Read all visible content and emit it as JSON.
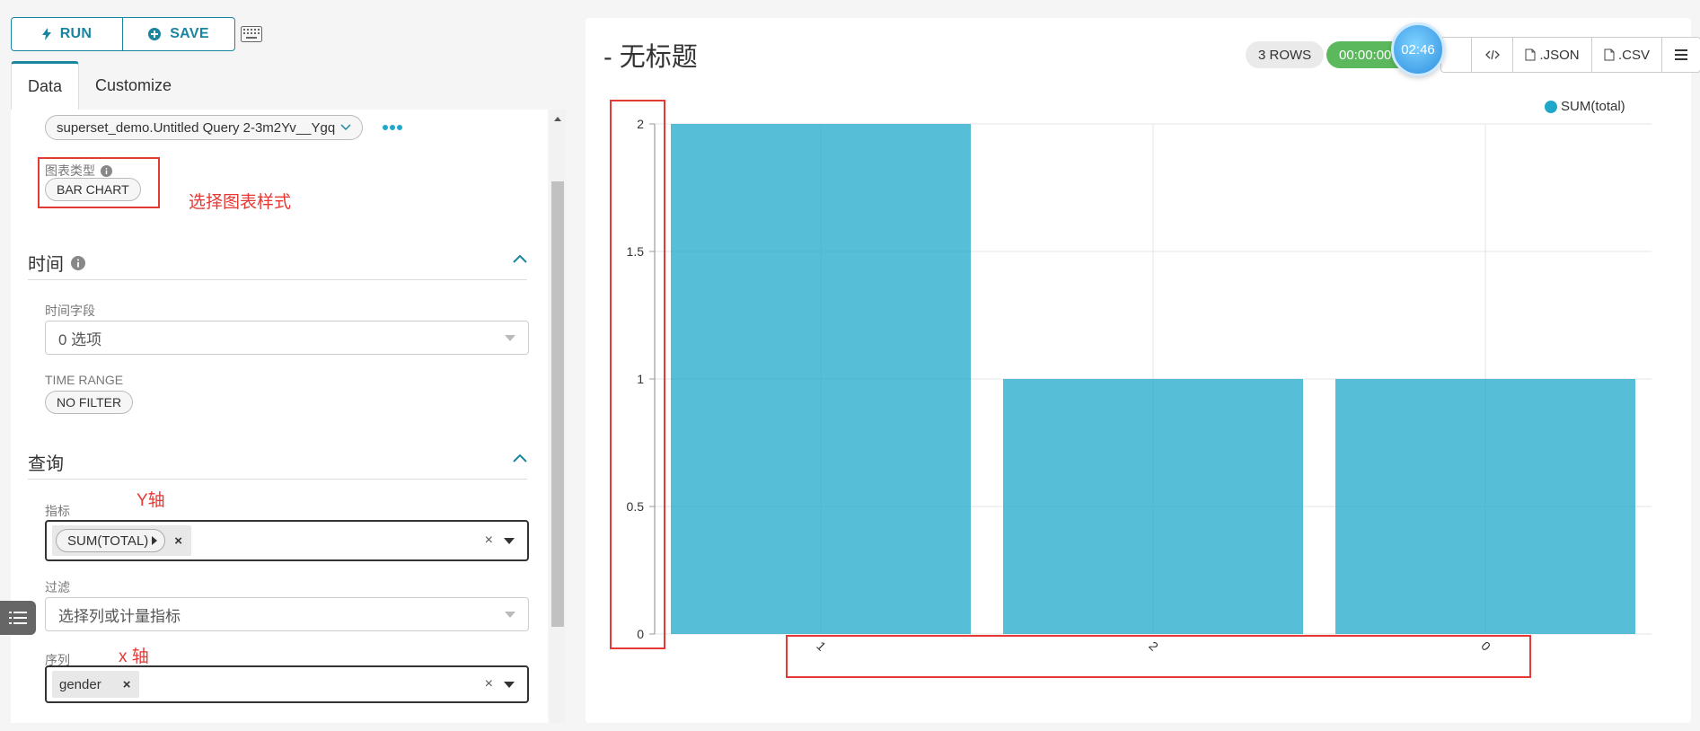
{
  "toolbar": {
    "run_label": "RUN",
    "save_label": "SAVE"
  },
  "tabs": [
    {
      "label": "Data",
      "active": true
    },
    {
      "label": "Customize",
      "active": false
    }
  ],
  "datasource": {
    "label_partial": "",
    "value": "superset_demo.Untitled Query 2-3m2Yv__Ygq"
  },
  "viz_type": {
    "label": "图表类型",
    "value": "BAR CHART",
    "annotation": "选择图表样式"
  },
  "time_section": {
    "title": "时间",
    "time_field_label": "时间字段",
    "time_field_value": "0 选项",
    "time_range_label": "TIME RANGE",
    "time_range_value": "NO FILTER"
  },
  "query_section": {
    "title": "查询",
    "metrics_label": "指标",
    "metrics_annotation": "Y轴",
    "metric_chip": "SUM(TOTAL)",
    "filters_label": "过滤",
    "filters_placeholder": "选择列或计量指标",
    "series_label": "序列",
    "series_annotation": "x 轴",
    "series_chip": "gender"
  },
  "header": {
    "title": "- 无标题",
    "rows": "3 ROWS",
    "elapsed": "00:00:00",
    "timer_bubble": "02:46",
    "json_label": ".JSON",
    "csv_label": ".CSV"
  },
  "colors": {
    "accent": "#1a85a0",
    "bar": "#1fa8c9",
    "success": "#5cb85c",
    "annotation": "#e53935"
  },
  "chart_data": {
    "type": "bar",
    "categories": [
      "1",
      "2",
      "0"
    ],
    "series": [
      {
        "name": "SUM(total)",
        "values": [
          2,
          1,
          1
        ]
      }
    ],
    "yticks": [
      "0",
      "0.5",
      "1",
      "1.5",
      "2"
    ],
    "ylim": [
      0,
      2
    ],
    "legend": "top-right",
    "grid": true,
    "xlabel": "",
    "ylabel": ""
  }
}
